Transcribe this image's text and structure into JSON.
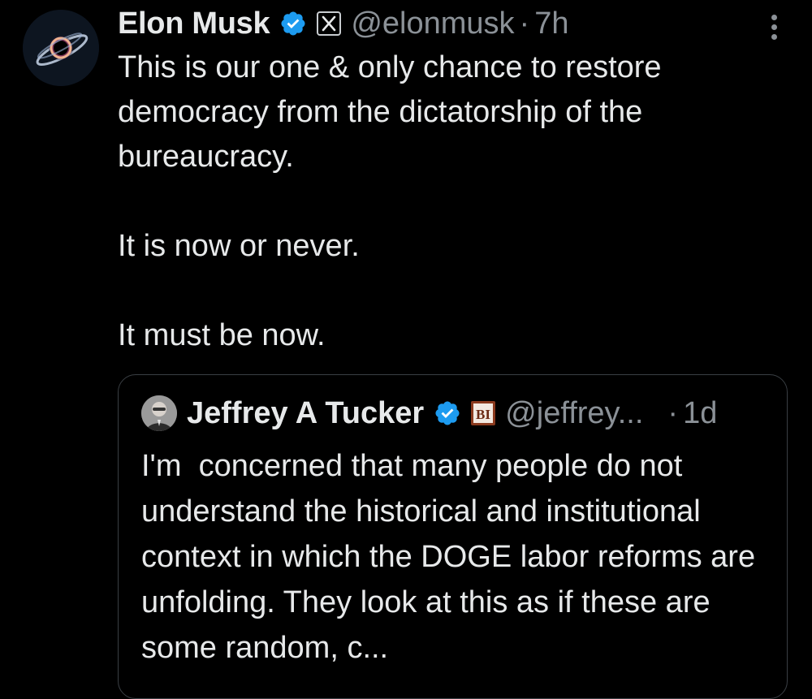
{
  "tweet": {
    "author": {
      "display_name": "Elon Musk",
      "handle": "@elonmusk",
      "verified_icon": "verified-badge-icon",
      "affiliation_icon": "x-logo-icon",
      "avatar": "black-hole-avatar"
    },
    "separator": "·",
    "timestamp": "7h",
    "more_icon": "more-vertical-icon",
    "text": {
      "line1": "This is our one & only chance to restore democracy from the dictatorship of the bureaucracy.",
      "line2": "It is now or never.",
      "line3": "It must be now."
    },
    "quote": {
      "author": {
        "display_name": "Jeffrey A Tucker",
        "handle": "@jeffrey...",
        "verified_icon": "verified-badge-icon",
        "affiliation_icon": "bi-logo-icon",
        "avatar": "profile-photo-avatar"
      },
      "separator": "·",
      "timestamp": "1d",
      "text": "I'm  concerned that many people do not understand the historical and institutional context in which the DOGE labor reforms are unfolding. They look at this as if these are some random, c..."
    }
  },
  "colors": {
    "background": "#000000",
    "primary_text": "#e7e9ea",
    "secondary_text": "#8b9197",
    "verified_blue": "#1d9bf0",
    "border": "#3a3f44",
    "bi_brown": "#8b3a1e"
  }
}
